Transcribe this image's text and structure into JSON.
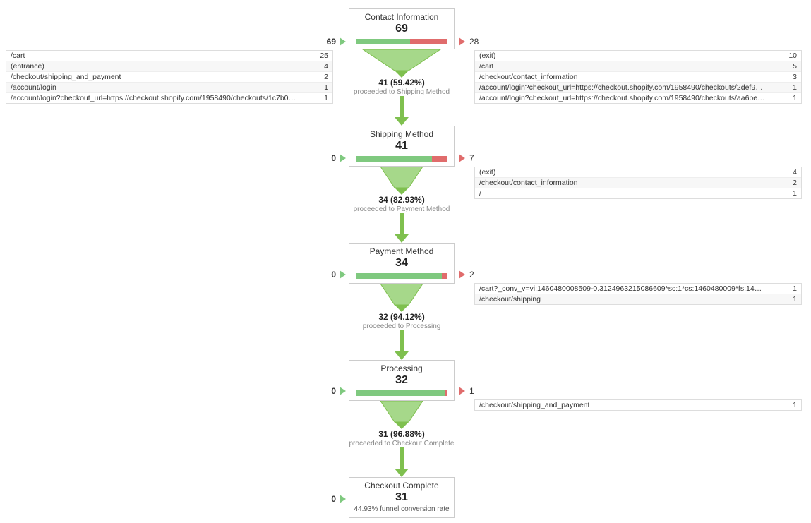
{
  "steps": [
    {
      "title": "Contact Information",
      "count": "69",
      "in_count": "69",
      "out_count": "28",
      "green_pct": 59.42,
      "proceed_pct": "41 (59.42%)",
      "proceed_txt": "proceeded to Shipping Method",
      "in_rows": [
        {
          "p": "/cart",
          "v": "25"
        },
        {
          "p": "(entrance)",
          "v": "4"
        },
        {
          "p": "/checkout/shipping_and_payment",
          "v": "2"
        },
        {
          "p": "/account/login",
          "v": "1"
        },
        {
          "p": "/account/login?checkout_url=https://checkout.shopify.com/1958490/checkouts/1c7b0a47085db91a...",
          "v": "1"
        }
      ],
      "out_rows": [
        {
          "p": "(exit)",
          "v": "10"
        },
        {
          "p": "/cart",
          "v": "5"
        },
        {
          "p": "/checkout/contact_information",
          "v": "3"
        },
        {
          "p": "/account/login?checkout_url=https://checkout.shopify.com/1958490/checkouts/2def97bb12b7b8b1...",
          "v": "1"
        },
        {
          "p": "/account/login?checkout_url=https://checkout.shopify.com/1958490/checkouts/aa6bee881742df93...",
          "v": "1"
        }
      ]
    },
    {
      "title": "Shipping Method",
      "count": "41",
      "in_count": "0",
      "out_count": "7",
      "green_pct": 82.93,
      "proceed_pct": "34 (82.93%)",
      "proceed_txt": "proceeded to Payment Method",
      "out_rows": [
        {
          "p": "(exit)",
          "v": "4"
        },
        {
          "p": "/checkout/contact_information",
          "v": "2"
        },
        {
          "p": "/",
          "v": "1"
        }
      ]
    },
    {
      "title": "Payment Method",
      "count": "34",
      "in_count": "0",
      "out_count": "2",
      "green_pct": 94.12,
      "proceed_pct": "32 (94.12%)",
      "proceed_txt": "proceeded to Processing",
      "out_rows": [
        {
          "p": "/cart?_conv_v=vi:1460480008509-0.3124963215086609*sc:1*cs:1460480009*fs:1460480009*pv:1...",
          "v": "1"
        },
        {
          "p": "/checkout/shipping",
          "v": "1"
        }
      ]
    },
    {
      "title": "Processing",
      "count": "32",
      "in_count": "0",
      "out_count": "1",
      "green_pct": 96.88,
      "proceed_pct": "31 (96.88%)",
      "proceed_txt": "proceeded to Checkout Complete",
      "out_rows": [
        {
          "p": "/checkout/shipping_and_payment",
          "v": "1"
        }
      ]
    },
    {
      "title": "Checkout Complete",
      "count": "31",
      "in_count": "0",
      "final_rate": "44.93% funnel conversion rate"
    }
  ]
}
